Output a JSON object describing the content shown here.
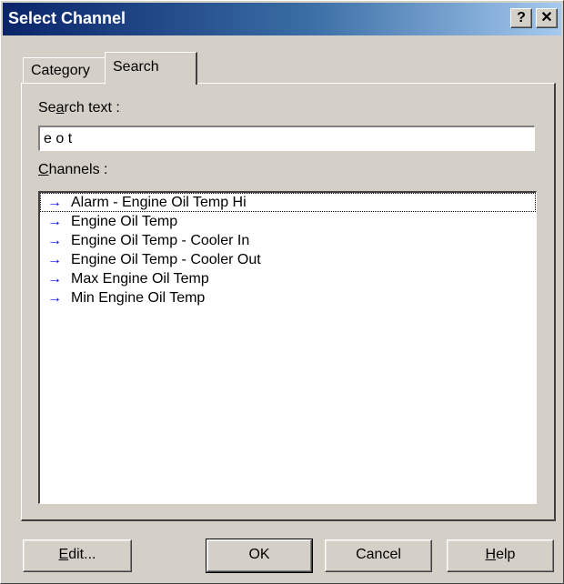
{
  "window": {
    "title": "Select Channel",
    "help_button": "?",
    "close_button": "✕"
  },
  "tabs": [
    {
      "label": "Category",
      "active": false
    },
    {
      "label": "Search",
      "active": true
    }
  ],
  "search": {
    "label_prefix": "Se",
    "label_accel": "a",
    "label_suffix": "rch text :",
    "value": "e o t"
  },
  "channels": {
    "label_accel": "C",
    "label_suffix": "hannels :",
    "items": [
      {
        "icon": "arrow-right-icon",
        "label": "Alarm - Engine Oil Temp Hi",
        "selected": true
      },
      {
        "icon": "arrow-right-icon",
        "label": "Engine Oil Temp",
        "selected": false
      },
      {
        "icon": "arrow-right-icon",
        "label": "Engine Oil Temp - Cooler In",
        "selected": false
      },
      {
        "icon": "arrow-right-icon",
        "label": "Engine Oil Temp - Cooler Out",
        "selected": false
      },
      {
        "icon": "arrow-right-icon",
        "label": "Max Engine Oil Temp",
        "selected": false
      },
      {
        "icon": "arrow-right-icon",
        "label": "Min Engine Oil Temp",
        "selected": false
      }
    ]
  },
  "buttons": {
    "edit_accel": "E",
    "edit_suffix": "dit...",
    "ok": "OK",
    "cancel": "Cancel",
    "help_accel": "H",
    "help_suffix": "elp"
  },
  "colors": {
    "titlebar_start": "#0a246a",
    "titlebar_end": "#a6caf0",
    "face": "#d4d0c8",
    "arrow": "#0000ff"
  }
}
